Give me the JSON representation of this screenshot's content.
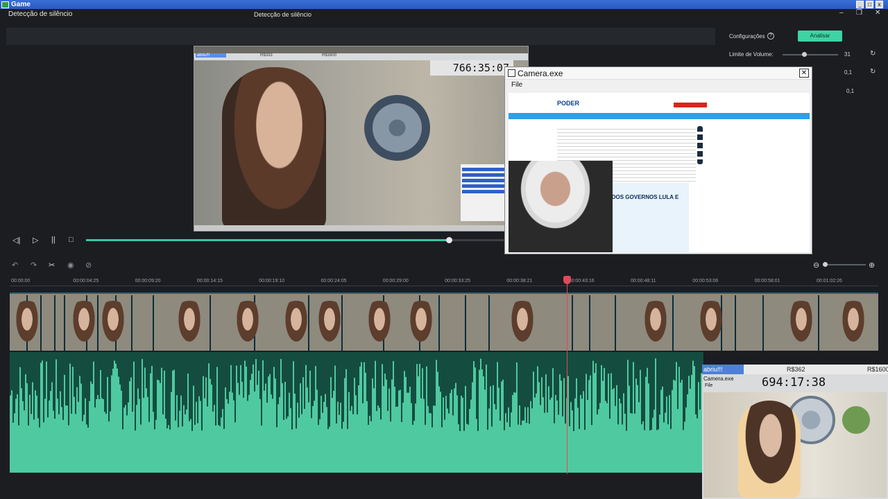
{
  "game_window": {
    "title": "Game"
  },
  "app": {
    "title": "Detecção de silêncio",
    "center_title": "Detecção de silêncio",
    "controls": [
      "–",
      "❐",
      "✕"
    ]
  },
  "video_overlay": {
    "name_tag": "abriu!!!",
    "money1": "R$333",
    "money2": "R$1600",
    "timer": "766:35:07"
  },
  "player": {
    "progress": 0.63,
    "controls": [
      "◁|",
      "▷",
      "||",
      "□"
    ]
  },
  "camera_window": {
    "title": "Camera.exe",
    "menu": "File",
    "page": {
      "logo": "PODER",
      "card_title": "COMPARAÇÃO DOS GOVERNOS LULA E BOLSONARO"
    }
  },
  "timeline": {
    "toolbar_icons": [
      "undo-icon",
      "redo-icon",
      "scissors-icon",
      "eye-icon",
      "hide-icon"
    ],
    "ticks": [
      "00:00:00",
      "00:00:04:25",
      "00:00:09:20",
      "00:00:14:15",
      "00:00:19:10",
      "00:00:24:05",
      "00:00:29:00",
      "00:00:33:25",
      "00:00:38:21",
      "00:00:43:16",
      "00:00:48:11",
      "00:00:53:06",
      "00:00:58:01",
      "00:01:02:26"
    ],
    "playhead_time": "00:00:43:16"
  },
  "settings": {
    "title": "Configurações",
    "analyze_label": "Analisar",
    "volume_label": "Limite de Volume:",
    "volume_value": "31",
    "volume_level": 0.39,
    "row2_value": "0,1",
    "row3_value": "0,1"
  },
  "stream_overlay": {
    "name_tag": "abriu!!!",
    "money1": "R$362",
    "money2": "R$1600",
    "cam_title": "Camera.exe",
    "cam_menu": "File",
    "timer": "694:17:38"
  }
}
